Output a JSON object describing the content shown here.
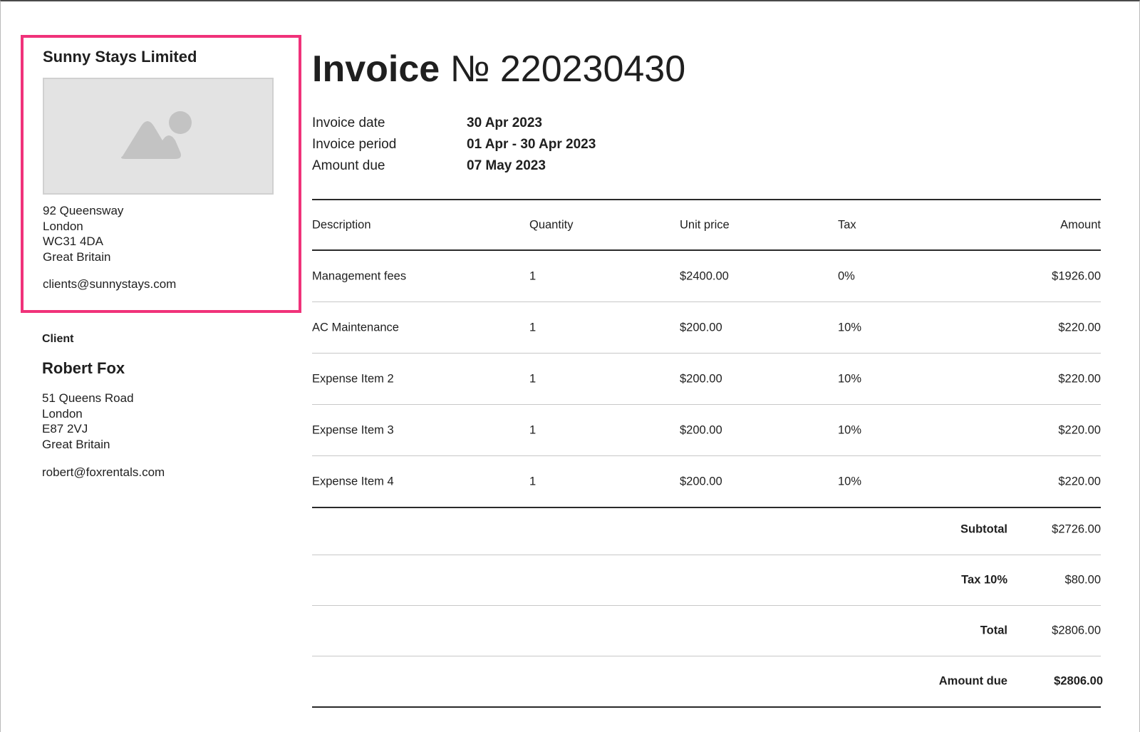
{
  "company": {
    "name": "Sunny Stays Limited",
    "logo_icon": "image-placeholder-icon",
    "address": [
      "92 Queensway",
      "London",
      "WC31 4DA",
      "Great Britain"
    ],
    "email": "clients@sunnystays.com",
    "highlight_color": "#f0327a"
  },
  "client": {
    "label": "Client",
    "name": "Robert Fox",
    "address": [
      "51 Queens Road",
      "London",
      "E87 2VJ",
      "Great Britain"
    ],
    "email": "robert@foxrentals.com"
  },
  "invoice": {
    "title_word": "Invoice",
    "number": "№ 220230430",
    "meta": [
      {
        "label": "Invoice date",
        "value": "30 Apr 2023"
      },
      {
        "label": "Invoice period",
        "value": "01 Apr - 30 Apr 2023"
      },
      {
        "label": "Amount due",
        "value": "07 May 2023"
      }
    ]
  },
  "table": {
    "headers": {
      "description": "Description",
      "quantity": "Quantity",
      "unit_price": "Unit price",
      "tax": "Tax",
      "amount": "Amount"
    },
    "rows": [
      {
        "description": "Management fees",
        "quantity": "1",
        "unit_price": "$2400.00",
        "tax": "0%",
        "amount": "$1926.00"
      },
      {
        "description": "AC Maintenance",
        "quantity": "1",
        "unit_price": "$200.00",
        "tax": "10%",
        "amount": "$220.00"
      },
      {
        "description": "Expense Item 2",
        "quantity": "1",
        "unit_price": "$200.00",
        "tax": "10%",
        "amount": "$220.00"
      },
      {
        "description": "Expense Item 3",
        "quantity": "1",
        "unit_price": "$200.00",
        "tax": "10%",
        "amount": "$220.00"
      },
      {
        "description": "Expense Item 4",
        "quantity": "1",
        "unit_price": "$200.00",
        "tax": "10%",
        "amount": "$220.00"
      }
    ]
  },
  "totals": [
    {
      "label": "Subtotal",
      "value": "$2726.00"
    },
    {
      "label": "Tax 10%",
      "value": "$80.00"
    },
    {
      "label": "Total",
      "value": "$2806.00"
    },
    {
      "label": "Amount due",
      "value": "$2806.00"
    }
  ]
}
